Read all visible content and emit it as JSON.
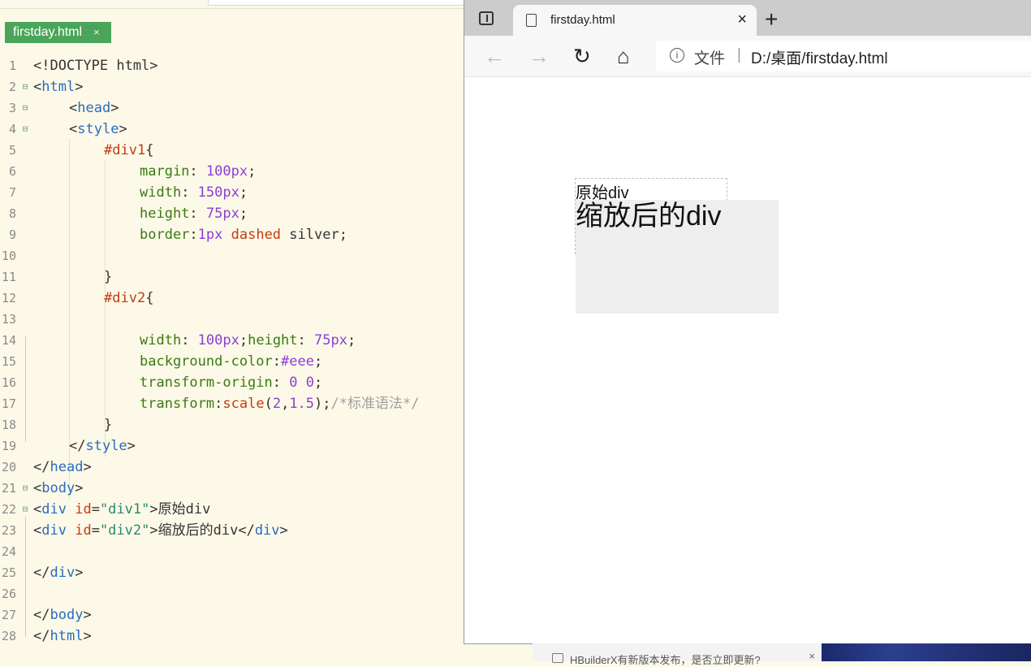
{
  "editor": {
    "tab_label": "firstday.html",
    "tab_close": "×",
    "lines": [
      {
        "n": "1",
        "fold": ""
      },
      {
        "n": "2",
        "fold": "⊟"
      },
      {
        "n": "3",
        "fold": "⊟"
      },
      {
        "n": "4",
        "fold": "⊟"
      },
      {
        "n": "5",
        "fold": ""
      },
      {
        "n": "6",
        "fold": ""
      },
      {
        "n": "7",
        "fold": ""
      },
      {
        "n": "8",
        "fold": ""
      },
      {
        "n": "9",
        "fold": ""
      },
      {
        "n": "10",
        "fold": ""
      },
      {
        "n": "11",
        "fold": ""
      },
      {
        "n": "12",
        "fold": ""
      },
      {
        "n": "13",
        "fold": ""
      },
      {
        "n": "14",
        "fold": ""
      },
      {
        "n": "15",
        "fold": ""
      },
      {
        "n": "16",
        "fold": ""
      },
      {
        "n": "17",
        "fold": ""
      },
      {
        "n": "18",
        "fold": ""
      },
      {
        "n": "19",
        "fold": ""
      },
      {
        "n": "20",
        "fold": ""
      },
      {
        "n": "21",
        "fold": "⊟"
      },
      {
        "n": "22",
        "fold": "⊟"
      },
      {
        "n": "23",
        "fold": ""
      },
      {
        "n": "24",
        "fold": ""
      },
      {
        "n": "25",
        "fold": ""
      },
      {
        "n": "26",
        "fold": ""
      },
      {
        "n": "27",
        "fold": ""
      },
      {
        "n": "28",
        "fold": ""
      }
    ],
    "code": {
      "l1": "<!DOCTYPE html>",
      "l2_o": "<",
      "l2_t": "html",
      "l2_c": ">",
      "l3_o": "<",
      "l3_t": "head",
      "l3_c": ">",
      "l4_o": "<",
      "l4_t": "style",
      "l4_c": ">",
      "l5_sel": "#div1",
      "l5_b": "{",
      "l6_p": "margin",
      "l6_c": ": ",
      "l6_n": "100px",
      "l6_e": ";",
      "l7_p": "width",
      "l7_c": ": ",
      "l7_n": "150px",
      "l7_e": ";",
      "l8_p": "height",
      "l8_c": ": ",
      "l8_n": "75px",
      "l8_e": ";",
      "l9_p": "border",
      "l9_c": ":",
      "l9_n": "1px",
      "l9_k": " dashed",
      "l9_v": " silver;",
      "l11": "}",
      "l12_sel": "#div2",
      "l12_b": "{",
      "l14_p1": "width",
      "l14_c1": ": ",
      "l14_n1": "100px",
      "l14_s": ";",
      "l14_p2": "height",
      "l14_c2": ": ",
      "l14_n2": "75px",
      "l14_e": ";",
      "l15_p": "background-color",
      "l15_c": ":",
      "l15_n": "#eee",
      "l15_e": ";",
      "l16_p": "transform-origin",
      "l16_c": ": ",
      "l16_n": "0 0",
      "l16_e": ";",
      "l17_p": "transform",
      "l17_c": ":",
      "l17_f": "scale",
      "l17_o": "(",
      "l17_n1": "2",
      "l17_m": ",",
      "l17_n2": "1.5",
      "l17_x": ");",
      "l17_cm": "/*标准语法*/",
      "l18": "}",
      "l19_o": "</",
      "l19_t": "style",
      "l19_c": ">",
      "l20_o": "</",
      "l20_t": "head",
      "l20_c": ">",
      "l21_o": "<",
      "l21_t": "body",
      "l21_c": ">",
      "l22_o": "<",
      "l22_t": "div",
      "l22_a": " id",
      "l22_eq": "=",
      "l22_s": "\"div1\"",
      "l22_c": ">",
      "l22_txt": "原始div",
      "l23_o": "<",
      "l23_t": "div",
      "l23_a": " id",
      "l23_eq": "=",
      "l23_s": "\"div2\"",
      "l23_c": ">",
      "l23_txt": "缩放后的div",
      "l23_o2": "</",
      "l23_t2": "div",
      "l23_c2": ">",
      "l25_o": "</",
      "l25_t": "div",
      "l25_c": ">",
      "l27_o": "</",
      "l27_t": "body",
      "l27_c": ">",
      "l28_o": "</",
      "l28_t": "html",
      "l28_c": ">"
    }
  },
  "browser": {
    "tab_title": "firstday.html",
    "tab_close": "×",
    "new_tab": "+",
    "back": "←",
    "forward": "→",
    "refresh": "↻",
    "home": "⌂",
    "info_glyph": "i",
    "addr_label": "文件",
    "addr_sep": "|",
    "url": "D:/桌面/firstday.html",
    "div1_text": "原始div",
    "div2_text": "缩放后的div"
  },
  "notification": {
    "message": "HBuilderX有新版本发布，是否立即更新?",
    "close": "×"
  }
}
